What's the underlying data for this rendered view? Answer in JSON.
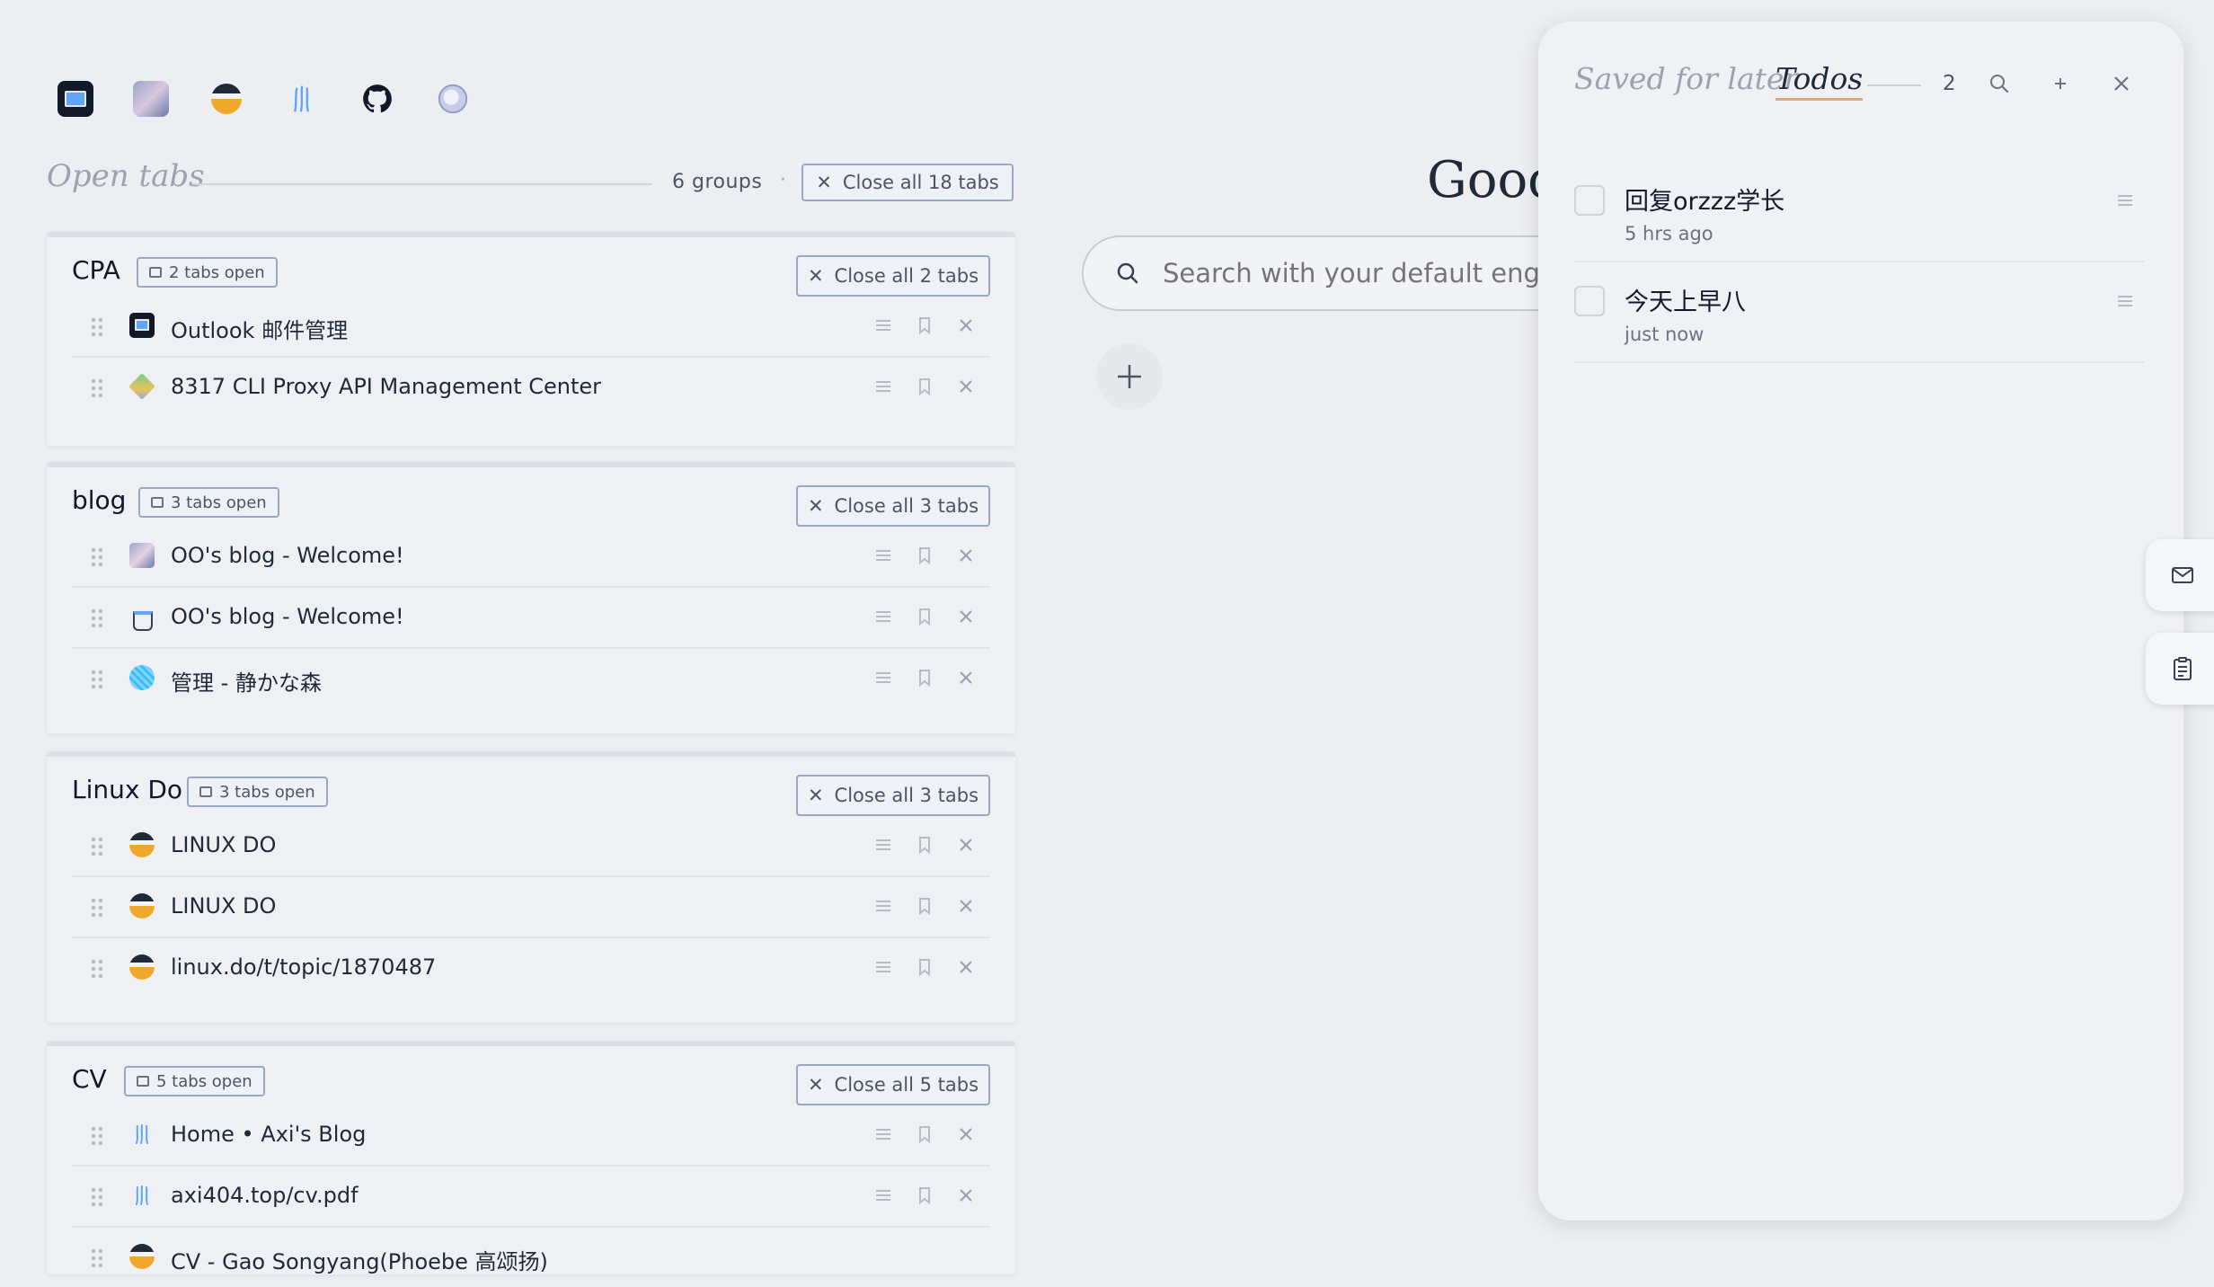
{
  "quick_links": [
    {
      "icon": "outlook-icon"
    },
    {
      "icon": "anime-avatar-icon"
    },
    {
      "icon": "linux-do-icon"
    },
    {
      "icon": "axi-blog-icon"
    },
    {
      "icon": "github-icon"
    },
    {
      "icon": "globe-icon"
    }
  ],
  "open_tabs": {
    "title": "Open tabs",
    "groups_count": "6 groups",
    "separator": "·",
    "close_all_label": "Close all 18 tabs"
  },
  "groups": [
    {
      "name": "CPA",
      "badge": "2 tabs open",
      "close_label": "Close all 2 tabs",
      "tabs": [
        {
          "title": "Outlook 邮件管理",
          "icon": "outlook-icon"
        },
        {
          "title": "8317 CLI Proxy API Management Center",
          "icon": "proxy-api-icon"
        }
      ]
    },
    {
      "name": "blog",
      "badge": "3 tabs open",
      "close_label": "Close all 3 tabs",
      "tabs": [
        {
          "title": "OO's blog - Welcome!",
          "icon": "anime-avatar-icon"
        },
        {
          "title": "OO's blog - Welcome!",
          "icon": "pot-icon"
        },
        {
          "title": "管理 - 静かな森",
          "icon": "yarn-ball-icon"
        }
      ]
    },
    {
      "name": "Linux Do",
      "badge": "3 tabs open",
      "close_label": "Close all 3 tabs",
      "tabs": [
        {
          "title": "LINUX DO",
          "icon": "linux-do-icon"
        },
        {
          "title": "LINUX DO",
          "icon": "linux-do-icon"
        },
        {
          "title": "linux.do/t/topic/1870487",
          "icon": "linux-do-icon"
        }
      ]
    },
    {
      "name": "CV",
      "badge": "5 tabs open",
      "close_label": "Close all 5 tabs",
      "tabs": [
        {
          "title": "Home • Axi's Blog",
          "icon": "axi-blog-icon"
        },
        {
          "title": "axi404.top/cv.pdf",
          "icon": "axi-blog-icon"
        },
        {
          "title": "CV - Gao Songyang(Phoebe 高颂扬)",
          "icon": "linux-do-icon"
        }
      ]
    }
  ],
  "greeting": "Good",
  "search": {
    "placeholder": "Search with your default engine..."
  },
  "panel": {
    "saved_label": "Saved for later",
    "todos_label": "Todos",
    "count": "2",
    "todos": [
      {
        "text": "回复orzzz学长",
        "time": "5 hrs ago"
      },
      {
        "text": "今天上早八",
        "time": "just now"
      }
    ]
  },
  "colors": {
    "background": "#eceef2",
    "accent_underline": "#e0a97a",
    "border": "#9aa9bf"
  }
}
